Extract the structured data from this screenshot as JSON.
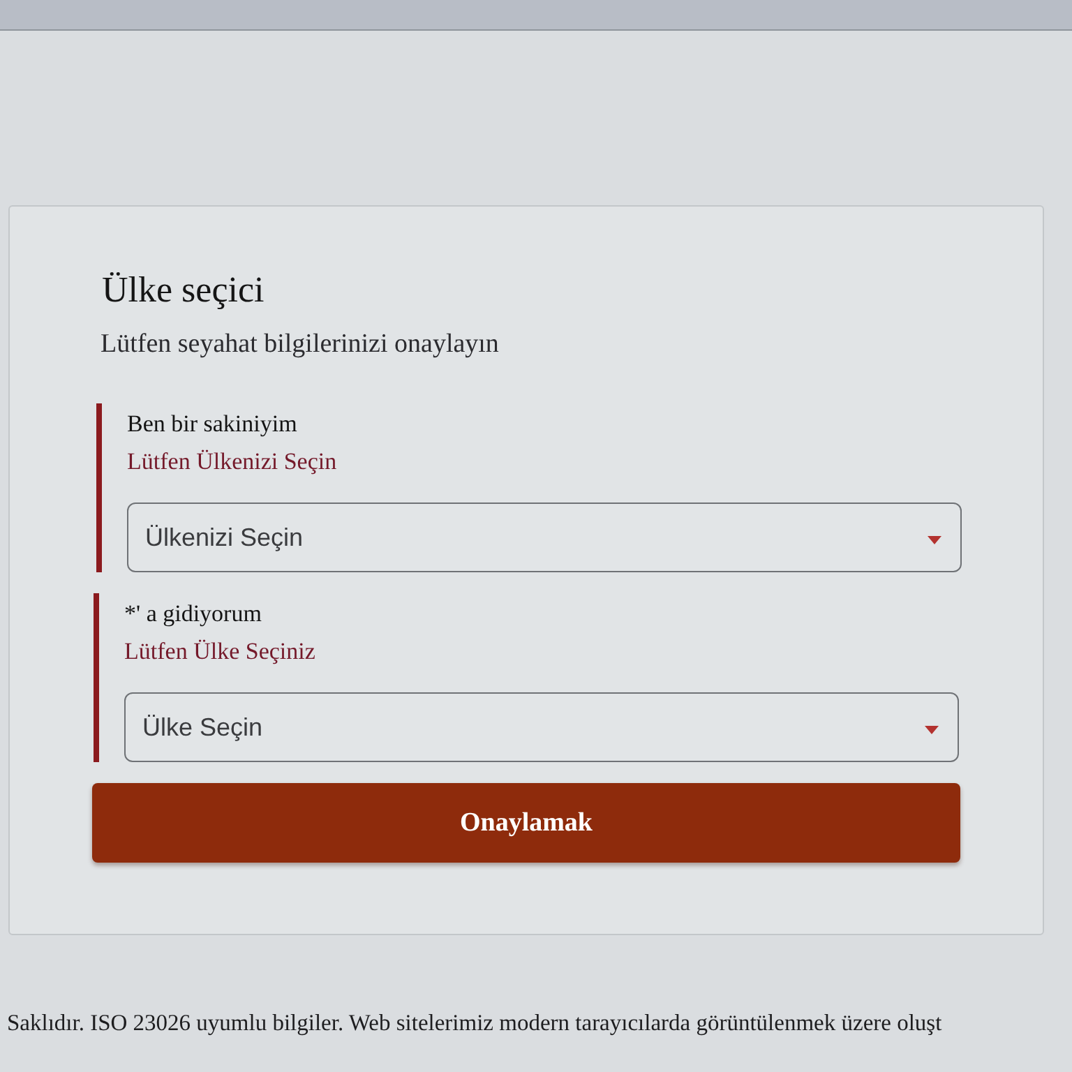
{
  "card": {
    "title": "Ülke seçici",
    "subtitle": "Lütfen seyahat bilgilerinizi onaylayın"
  },
  "fields": [
    {
      "label": "Ben bir sakiniyim",
      "invalid": true,
      "error_message": "Lütfen Ülkenizi Seçin",
      "placeholder": "Ülkenizi Seçin"
    },
    {
      "label": "*' a gidiyorum",
      "invalid": true,
      "error_message": "Lütfen Ülke Seçiniz",
      "placeholder": "Ülke Seçin"
    }
  ],
  "submit_button": {
    "label": "Onaylamak"
  },
  "footer": {
    "text": "Saklıdır. ISO 23026 uyumlu bilgiler. Web sitelerimiz modern tarayıcılarda görüntülenmek üzere oluşt"
  }
}
